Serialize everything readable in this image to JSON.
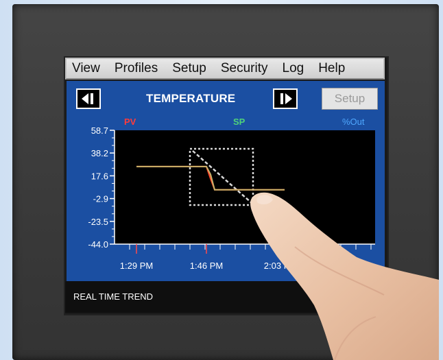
{
  "menu": {
    "items": [
      "View",
      "Profiles",
      "Setup",
      "Security",
      "Log",
      "Help"
    ]
  },
  "panel": {
    "title": "TEMPERATURE",
    "setup_label": "Setup",
    "prev_icon": "step-back-icon",
    "next_icon": "step-forward-icon"
  },
  "chart_data": {
    "type": "line",
    "title": "TEMPERATURE",
    "legend": [
      "PV",
      "SP",
      "%Out"
    ],
    "legend_colors": [
      "#ff3b3b",
      "#4fd37a",
      "#4fa8ff"
    ],
    "y_ticks": [
      "58.7",
      "38.2",
      "17.6",
      "-2.9",
      "-23.5",
      "-44.0"
    ],
    "x_ticks": [
      "1:29 PM",
      "1:46 PM",
      "2:03 PM"
    ],
    "ylim": [
      -44.0,
      58.7
    ],
    "series": [
      {
        "name": "PV",
        "x": [
          "1:29 PM",
          "1:46 PM",
          "1:47 PM",
          "1:48 PM",
          "2:05 PM"
        ],
        "values": [
          26,
          26,
          15,
          5,
          5
        ]
      },
      {
        "name": "SP",
        "x": [
          "1:29 PM",
          "1:46 PM",
          "1:47 PM",
          "1:48 PM",
          "2:05 PM"
        ],
        "values": [
          26,
          26,
          19,
          5,
          5
        ]
      }
    ]
  },
  "statusbar": {
    "text": "REAL TIME TREND"
  }
}
